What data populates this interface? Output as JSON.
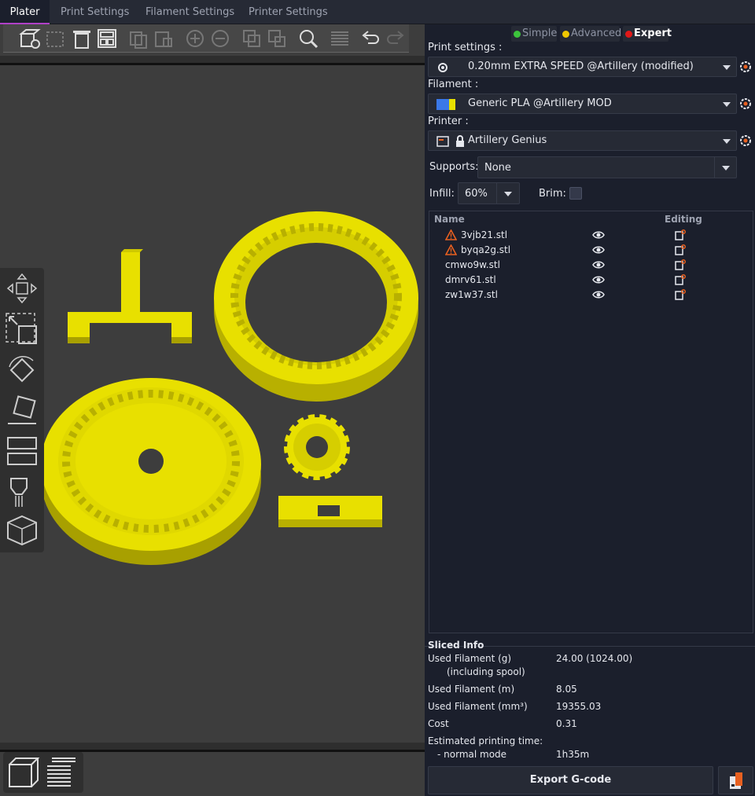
{
  "tabs": [
    {
      "label": "Plater",
      "active": true
    },
    {
      "label": "Print Settings",
      "active": false
    },
    {
      "label": "Filament Settings",
      "active": false
    },
    {
      "label": "Printer Settings",
      "active": false
    }
  ],
  "modes": {
    "simple": "Simple",
    "advanced": "Advanced",
    "expert": "Expert",
    "colors": {
      "simple": "#3cc43c",
      "advanced": "#f0c800",
      "expert": "#e01818"
    },
    "active": "expert"
  },
  "print_settings": {
    "label": "Print settings :",
    "value": "0.20mm EXTRA SPEED @Artillery (modified)"
  },
  "filament": {
    "label": "Filament :",
    "value": "Generic PLA @Artillery MOD"
  },
  "printer": {
    "label": "Printer :",
    "value": "Artillery Genius"
  },
  "supports": {
    "label": "Supports:",
    "value": "None"
  },
  "infill": {
    "label": "Infill:",
    "value": "60%"
  },
  "brim": {
    "label": "Brim:",
    "checked": false
  },
  "object_list": {
    "headers": {
      "name": "Name",
      "editing": "Editing"
    },
    "items": [
      {
        "name": "3vjb21.stl",
        "warning": true
      },
      {
        "name": "byqa2g.stl",
        "warning": true
      },
      {
        "name": "cmwo9w.stl",
        "warning": false
      },
      {
        "name": "dmrv61.stl",
        "warning": false
      },
      {
        "name": "zw1w37.stl",
        "warning": false
      }
    ]
  },
  "sliced_info": {
    "title": "Sliced Info",
    "used_filament_g_label": "Used Filament (g)",
    "including_spool_label": "(including spool)",
    "used_filament_g_value": "24.00 (1024.00)",
    "used_filament_m_label": "Used Filament (m)",
    "used_filament_m_value": "8.05",
    "used_filament_mm3_label": "Used Filament (mm³)",
    "used_filament_mm3_value": "19355.03",
    "cost_label": "Cost",
    "cost_value": "0.31",
    "est_time_label": "Estimated printing time:",
    "normal_mode_label": "- normal mode",
    "normal_mode_value": "1h35m"
  },
  "export_button": "Export G-code",
  "model_color": "#e8e000",
  "accent_color": "#b040c8"
}
